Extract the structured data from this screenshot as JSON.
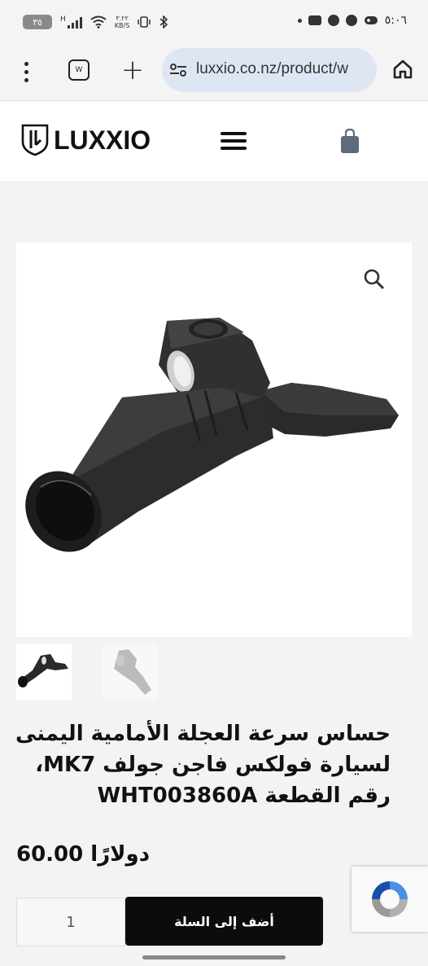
{
  "status_bar": {
    "time": "٥:٠٦",
    "battery": "٣٥",
    "network_type": "H",
    "speed_value": "٣.٢٢",
    "speed_unit": "KB/S"
  },
  "browser": {
    "tab_count": "W",
    "url": "luxxio.co.nz/product/w"
  },
  "site": {
    "logo_text": "LUXXIO"
  },
  "product": {
    "title": "حساس سرعة العجلة الأمامية اليمنى لسيارة فولكس فاجن جولف MK7، رقم القطعة WHT003860A",
    "price": "دولارًا 60.00",
    "quantity": "1",
    "add_to_cart_label": "أضف إلى السلة"
  },
  "colors": {
    "button_bg": "#0c0c0c",
    "url_bar_bg": "#dfe6f3",
    "page_bg": "#f3f4f2"
  }
}
